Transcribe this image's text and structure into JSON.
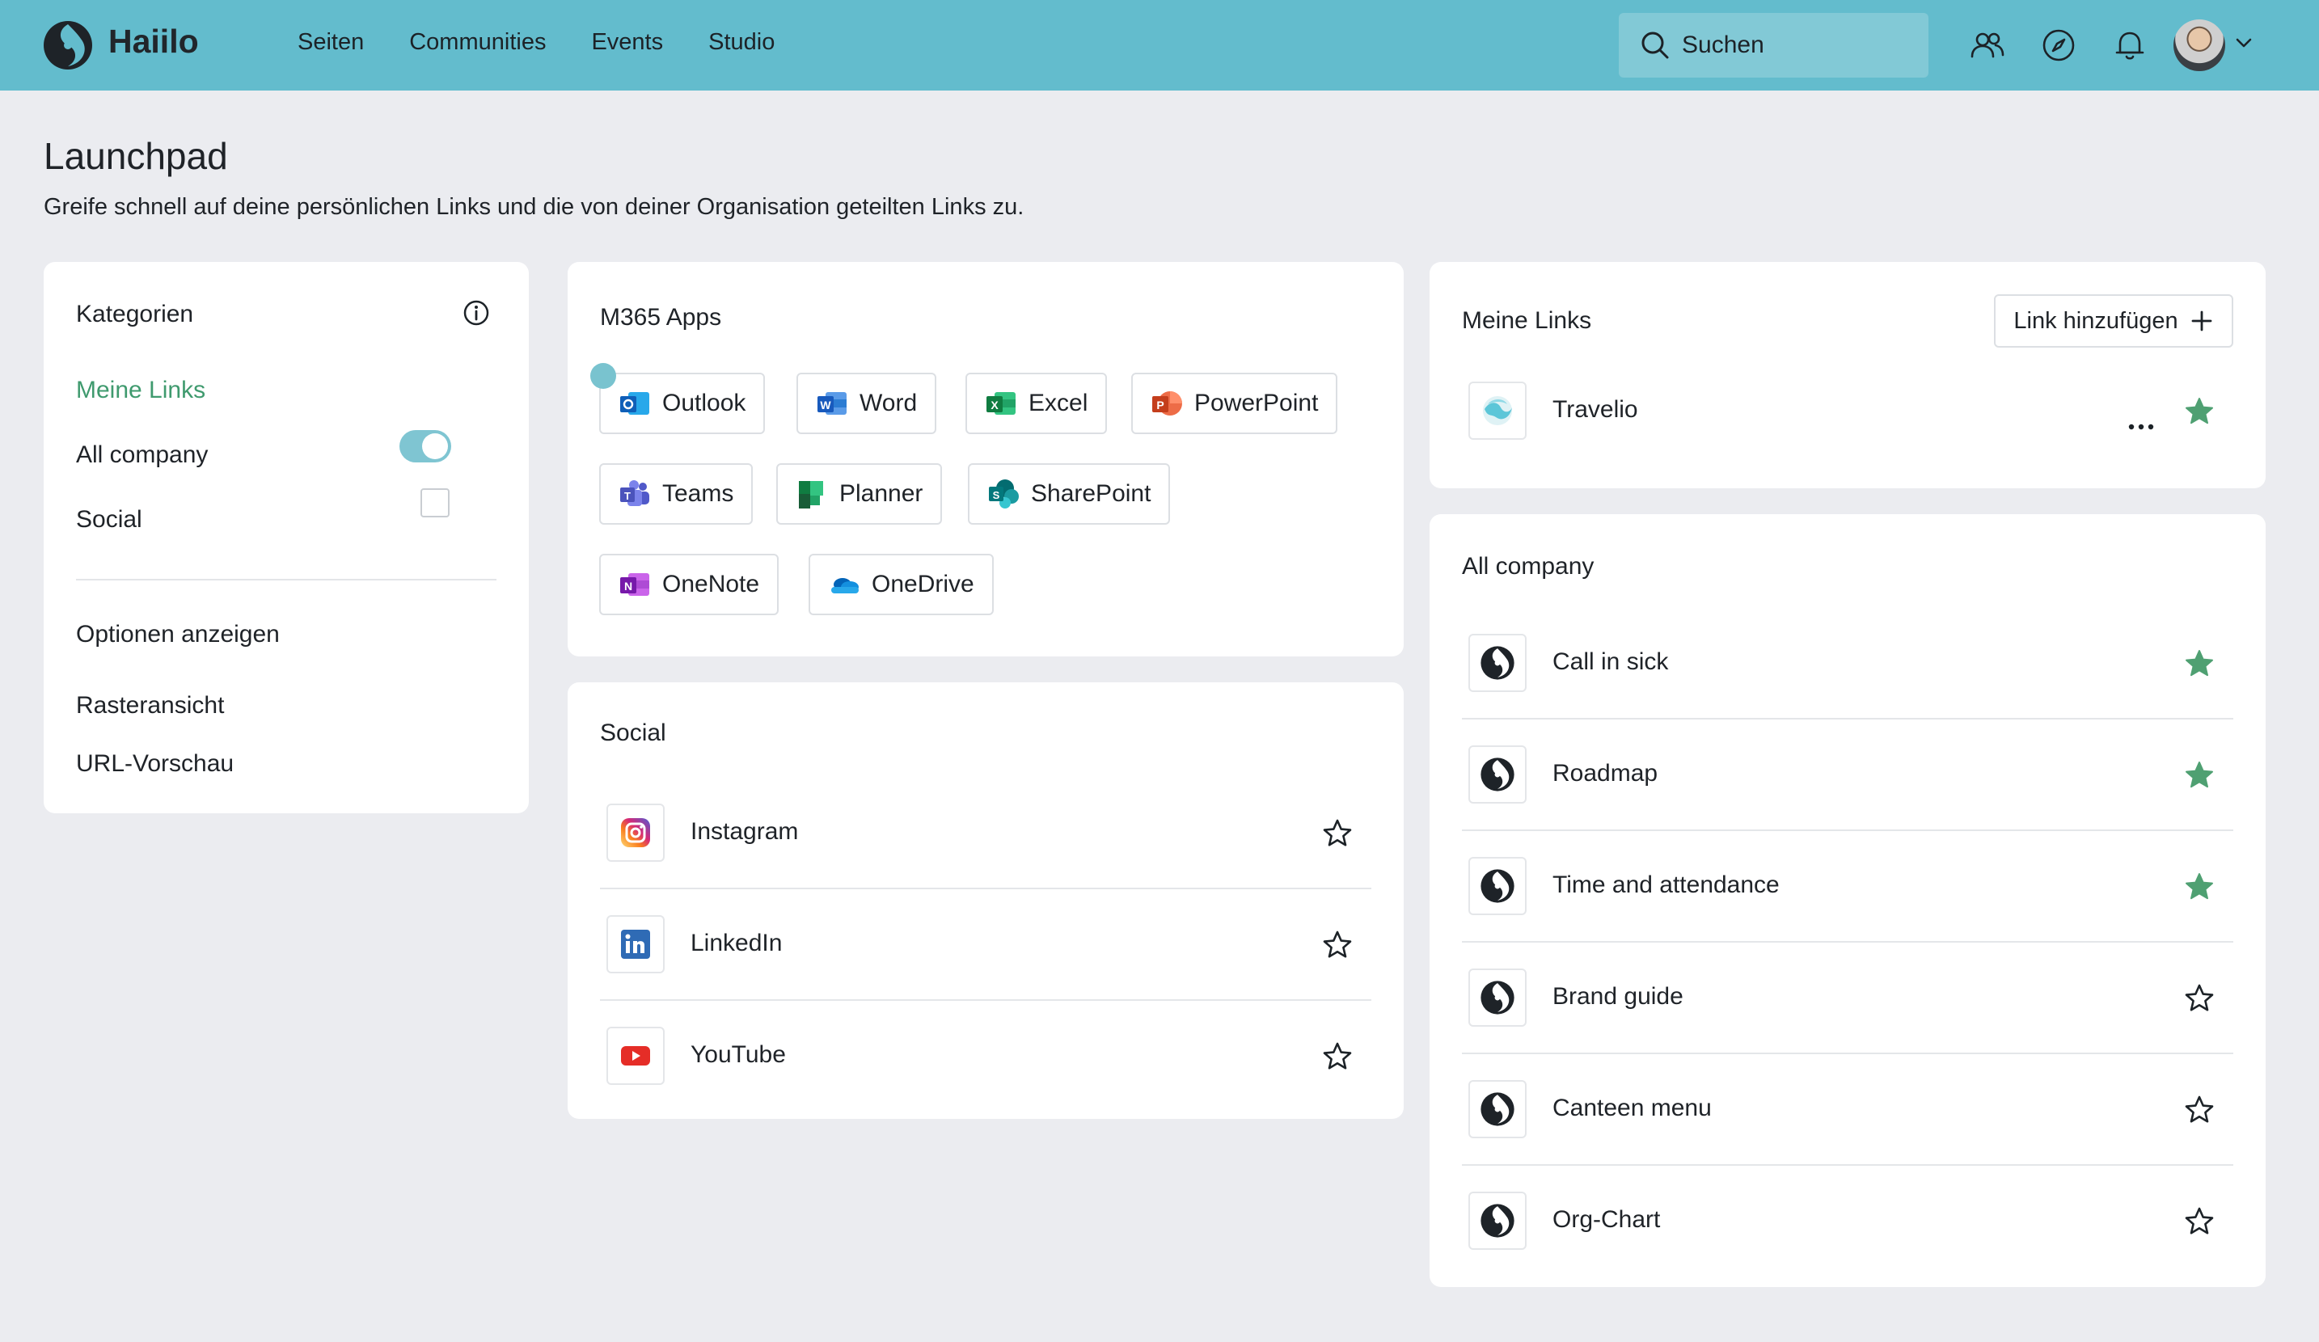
{
  "nav": {
    "brand": "Haiilo",
    "links": [
      "Seiten",
      "Communities",
      "Events",
      "Studio"
    ],
    "search_label": "Suchen"
  },
  "page": {
    "title": "Launchpad",
    "subtitle": "Greife schnell auf deine persönlichen Links und die von deiner Organisation geteilten Links zu."
  },
  "categories": {
    "title": "Kategorien",
    "items": [
      "Meine Links",
      "All company",
      "Social"
    ],
    "active": "Meine Links",
    "options_title": "Optionen anzeigen",
    "options": [
      {
        "label": "Rasteransicht",
        "enabled": true
      },
      {
        "label": "URL-Vorschau",
        "enabled": false
      }
    ]
  },
  "m365": {
    "title": "M365 Apps",
    "apps": [
      "Outlook",
      "Word",
      "Excel",
      "PowerPoint",
      "Teams",
      "Planner",
      "SharePoint",
      "OneNote",
      "OneDrive"
    ]
  },
  "social": {
    "title": "Social",
    "items": [
      {
        "label": "Instagram",
        "starred": false
      },
      {
        "label": "LinkedIn",
        "starred": false
      },
      {
        "label": "YouTube",
        "starred": false
      }
    ]
  },
  "my_links": {
    "title": "Meine Links",
    "add_label": "Link hinzufügen",
    "items": [
      {
        "label": "Travelio",
        "starred": true
      }
    ]
  },
  "all_company": {
    "title": "All company",
    "items": [
      {
        "label": "Call in sick",
        "starred": true
      },
      {
        "label": "Roadmap",
        "starred": true
      },
      {
        "label": "Time and attendance",
        "starred": true
      },
      {
        "label": "Brand guide",
        "starred": false
      },
      {
        "label": "Canteen menu",
        "starred": false
      },
      {
        "label": "Org-Chart",
        "starred": false
      }
    ]
  },
  "colors": {
    "nav_bg": "#63bccd",
    "accent_green": "#3f9a6e",
    "star_filled": "#4fa072"
  }
}
